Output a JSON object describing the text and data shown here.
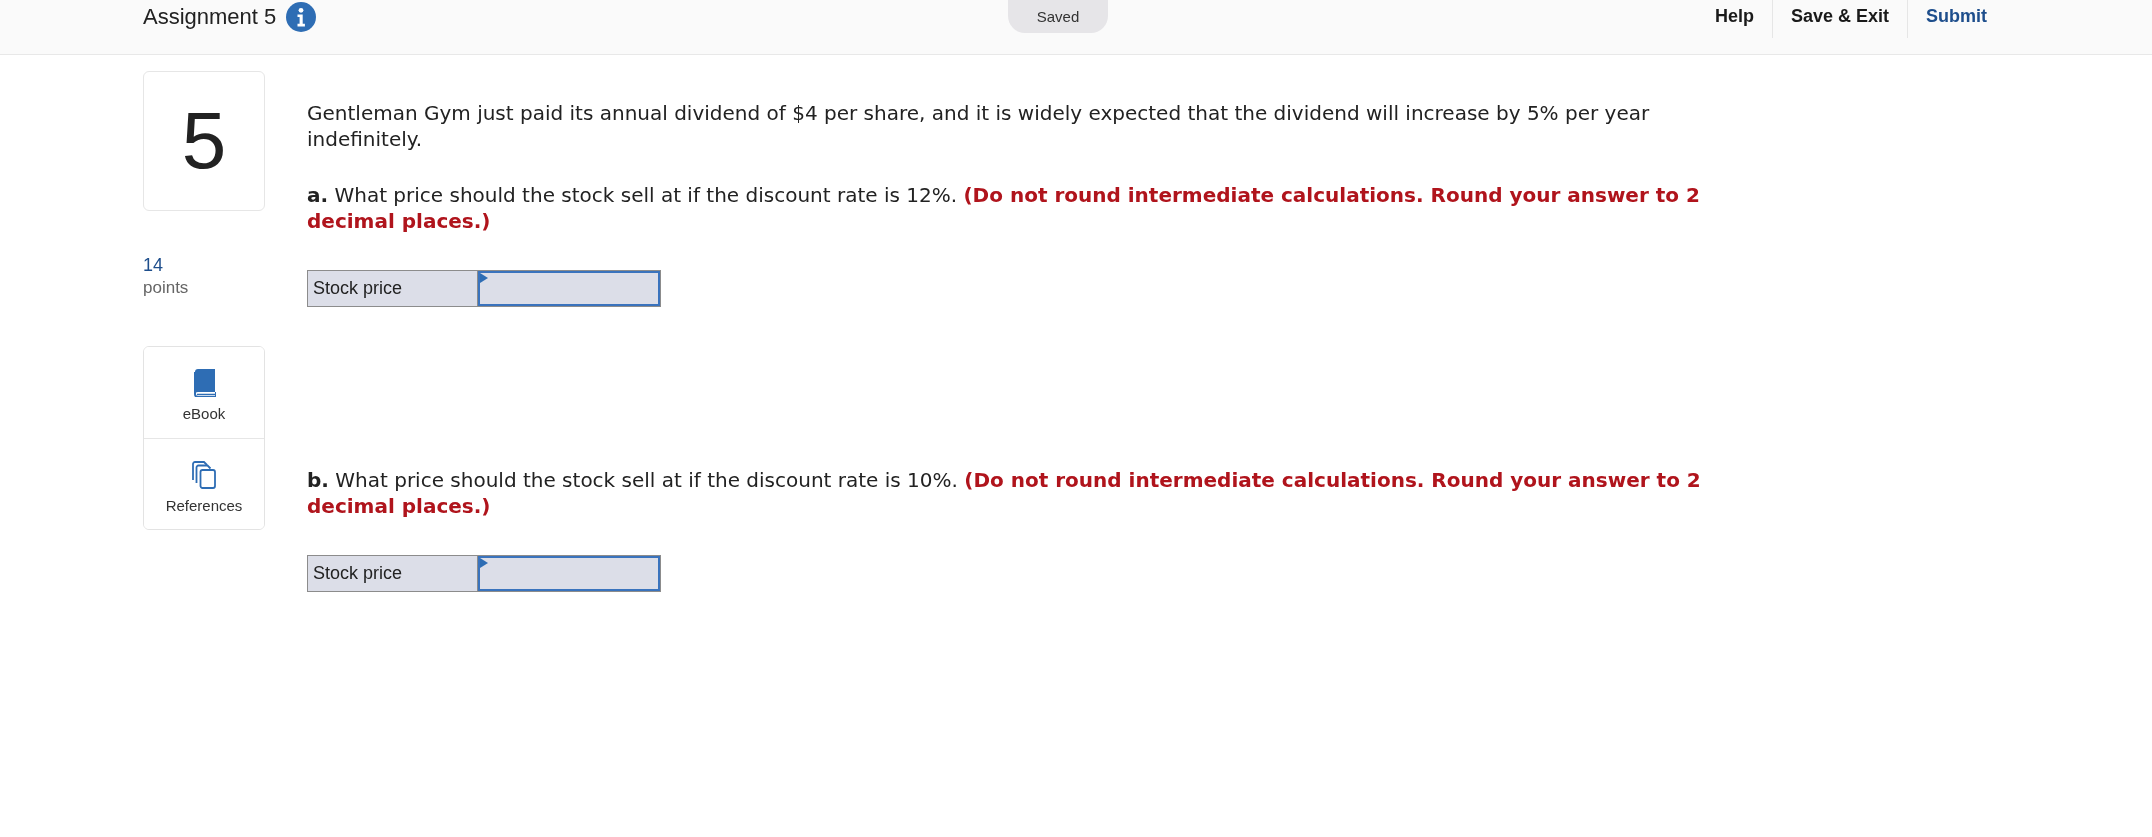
{
  "header": {
    "title": "Assignment 5",
    "status": "Saved",
    "links": [
      {
        "label": "Help",
        "kind": "plain"
      },
      {
        "label": "Save & Exit",
        "kind": "plain"
      },
      {
        "label": "Submit",
        "kind": "primary"
      }
    ]
  },
  "question": {
    "number": "5",
    "points": "14",
    "points_label": "points"
  },
  "tools": [
    {
      "label": "eBook",
      "kind": "ebook"
    },
    {
      "label": "References",
      "kind": "references"
    }
  ],
  "prompt": "Gentleman Gym just paid its annual dividend of $4 per share, and it is widely expected that the dividend will increase by 5% per year indefinitely.",
  "parts": [
    {
      "text": "**a.** What price should the stock sell at if the discount rate is 12%.",
      "instruction": "(Do not round intermediate calculations. Round your answer to 2 decimal places.)",
      "answer": {
        "label": "Stock price"
      }
    },
    {
      "text": "**b.** What price should the stock sell at if the discount rate is 10%.",
      "instruction": "(Do not round intermediate calculations. Round your answer to 2 decimal places.)",
      "answer": {
        "label": "Stock price"
      }
    }
  ]
}
